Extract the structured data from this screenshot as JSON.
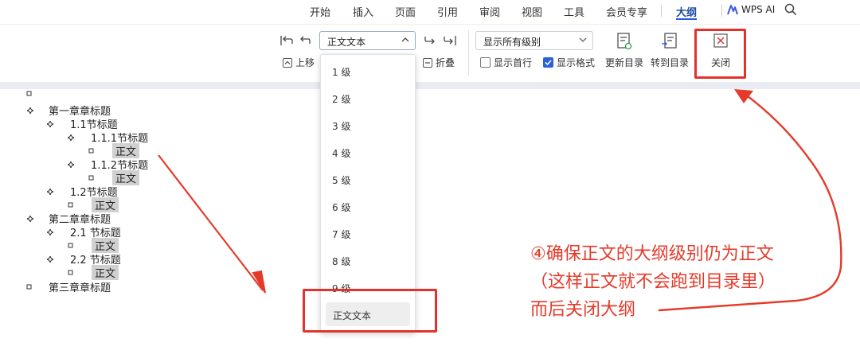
{
  "menu": {
    "tabs": [
      {
        "label": "开始"
      },
      {
        "label": "插入"
      },
      {
        "label": "页面"
      },
      {
        "label": "引用"
      },
      {
        "label": "审阅"
      },
      {
        "label": "视图"
      },
      {
        "label": "工具"
      },
      {
        "label": "会员专享"
      },
      {
        "label": "大纲",
        "active": true
      }
    ],
    "ai_label": "WPS AI",
    "accent": "#2a5ad9"
  },
  "ribbon": {
    "level_value": "正文文本",
    "move_up": "上移",
    "collapse": "折叠",
    "show_levels": "显示所有级别",
    "show_first_line": "显示首行",
    "show_format": "显示格式",
    "update_toc": "更新目录",
    "goto_toc": "转到目录",
    "close": "关闭"
  },
  "checkboxes": {
    "show_first_line": false,
    "show_format": true
  },
  "dropdown": {
    "options": [
      "1 级",
      "2 级",
      "3 级",
      "4 级",
      "5 级",
      "6 级",
      "7 级",
      "8 级",
      "9 级",
      "正文文本"
    ],
    "selected": "正文文本"
  },
  "outline": [
    {
      "text": "",
      "level": 0,
      "bullet": "square"
    },
    {
      "text": "第一章章标题",
      "level": 1,
      "bullet": "plus"
    },
    {
      "text": "1.1节标题",
      "level": 2,
      "bullet": "plus"
    },
    {
      "text": "1.1.1节标题",
      "level": 3,
      "bullet": "plus"
    },
    {
      "text": "正文",
      "level": 4,
      "bullet": "square",
      "body": true
    },
    {
      "text": "1.1.2节标题",
      "level": 3,
      "bullet": "plus"
    },
    {
      "text": "正文",
      "level": 4,
      "bullet": "square",
      "body": true
    },
    {
      "text": "1.2节标题",
      "level": 2,
      "bullet": "plus"
    },
    {
      "text": "正文",
      "level": 3,
      "bullet": "square",
      "body": true
    },
    {
      "text": "第二章章标题",
      "level": 1,
      "bullet": "plus"
    },
    {
      "text": "2.1 节标题",
      "level": 2,
      "bullet": "plus"
    },
    {
      "text": "正文",
      "level": 3,
      "bullet": "square",
      "body": true
    },
    {
      "text": "2.2 节标题",
      "level": 2,
      "bullet": "plus"
    },
    {
      "text": "正文",
      "level": 3,
      "bullet": "square",
      "body": true
    },
    {
      "text": "第三章章标题",
      "level": 1,
      "bullet": "square"
    }
  ],
  "annotation": {
    "lines": [
      "④确保正文的大纲级别仍为正文",
      "（这样正文就不会跑到目录里）",
      "而后关闭大纲"
    ],
    "color": "#e53a2a"
  }
}
